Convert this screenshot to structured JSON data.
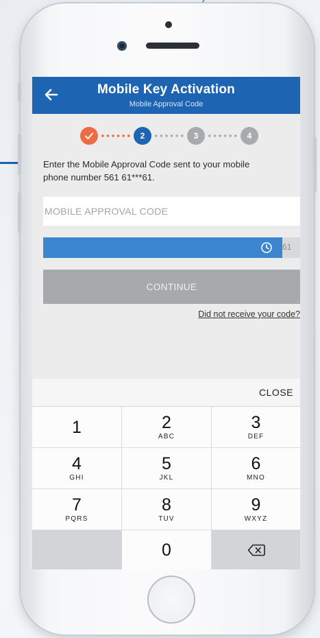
{
  "header": {
    "title": "Mobile Key Activation",
    "subtitle": "Mobile Approval Code"
  },
  "stepper": {
    "steps": [
      "2",
      "3",
      "4"
    ],
    "current_step": 2,
    "total_steps": 4
  },
  "instruction": {
    "line1": "Enter the Mobile Approval Code sent to your mobile",
    "line2": "phone number 561 61***61."
  },
  "code_input": {
    "value": "",
    "placeholder": "MOBILE APPROVAL CODE"
  },
  "timer": {
    "text": "61",
    "progress": 0.93
  },
  "actions": {
    "continue_label": "CONTINUE",
    "resend_label": "Did not receive your code?"
  },
  "keypad": {
    "close_label": "CLOSE",
    "keys": [
      {
        "num": "1",
        "letters": ""
      },
      {
        "num": "2",
        "letters": "ABC"
      },
      {
        "num": "3",
        "letters": "DEF"
      },
      {
        "num": "4",
        "letters": "GHI"
      },
      {
        "num": "5",
        "letters": "JKL"
      },
      {
        "num": "6",
        "letters": "MNO"
      },
      {
        "num": "7",
        "letters": "PQRS"
      },
      {
        "num": "8",
        "letters": "TUV"
      },
      {
        "num": "9",
        "letters": "WXYZ"
      },
      {
        "num": "0",
        "letters": ""
      }
    ]
  },
  "colors": {
    "brand_blue": "#1d65b2",
    "step_done": "#ef6b43",
    "step_todo": "#a8abae",
    "timer_fill": "#3c85cf",
    "button_disabled": "#a7aaad"
  },
  "icons": {
    "back": "arrow-left-icon",
    "step_done": "checkmark-icon",
    "timer": "clock-icon",
    "backspace": "backspace-icon"
  }
}
